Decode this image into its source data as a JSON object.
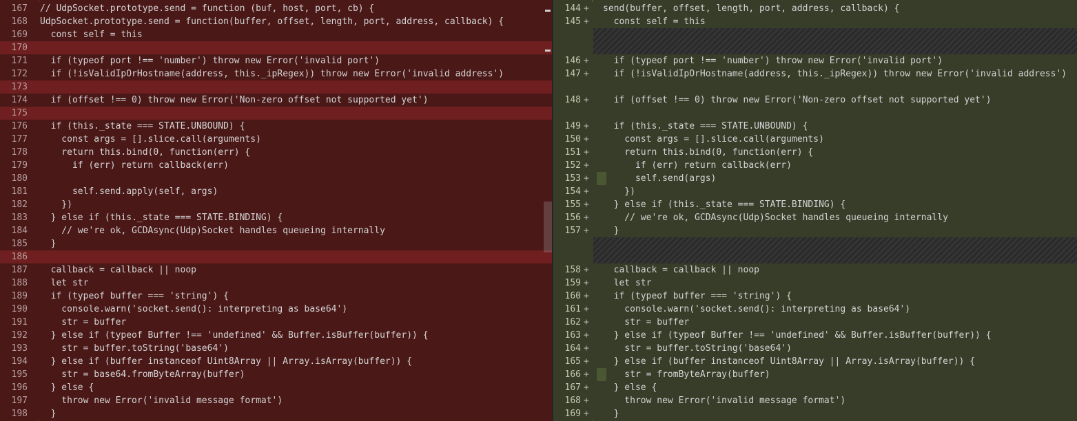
{
  "left": {
    "rows": [
      {
        "ln": "167",
        "code": "// UdpSocket.prototype.send = function (buf, host, port, cb) {"
      },
      {
        "ln": "168",
        "code": "UdpSocket.prototype.send = function(buffer, offset, length, port, address, callback) {"
      },
      {
        "ln": "169",
        "code": "  const self = this"
      },
      {
        "ln": "170",
        "code": ""
      },
      {
        "ln": "171",
        "code": "  if (typeof port !== 'number') throw new Error('invalid port')"
      },
      {
        "ln": "172",
        "code": "  if (!isValidIpOrHostname(address, this._ipRegex)) throw new Error('invalid address')"
      },
      {
        "ln": "173",
        "code": ""
      },
      {
        "ln": "174",
        "code": "  if (offset !== 0) throw new Error('Non-zero offset not supported yet')"
      },
      {
        "ln": "175",
        "code": ""
      },
      {
        "ln": "176",
        "code": "  if (this._state === STATE.UNBOUND) {"
      },
      {
        "ln": "177",
        "code": "    const args = [].slice.call(arguments)"
      },
      {
        "ln": "178",
        "code": "    return this.bind(0, function(err) {"
      },
      {
        "ln": "179",
        "code": "      if (err) return callback(err)"
      },
      {
        "ln": "180",
        "code": ""
      },
      {
        "ln": "181",
        "code": "      self.send.apply(self, args)"
      },
      {
        "ln": "182",
        "code": "    })"
      },
      {
        "ln": "183",
        "code": "  } else if (this._state === STATE.BINDING) {"
      },
      {
        "ln": "184",
        "code": "    // we're ok, GCDAsync(Udp)Socket handles queueing internally"
      },
      {
        "ln": "185",
        "code": "  }"
      },
      {
        "ln": "186",
        "code": ""
      },
      {
        "ln": "187",
        "code": "  callback = callback || noop"
      },
      {
        "ln": "188",
        "code": "  let str"
      },
      {
        "ln": "189",
        "code": "  if (typeof buffer === 'string') {"
      },
      {
        "ln": "190",
        "code": "    console.warn('socket.send(): interpreting as base64')"
      },
      {
        "ln": "191",
        "code": "    str = buffer"
      },
      {
        "ln": "192",
        "code": "  } else if (typeof Buffer !== 'undefined' && Buffer.isBuffer(buffer)) {"
      },
      {
        "ln": "193",
        "code": "    str = buffer.toString('base64')"
      },
      {
        "ln": "194",
        "code": "  } else if (buffer instanceof Uint8Array || Array.isArray(buffer)) {"
      },
      {
        "ln": "195",
        "code": "    str = base64.fromByteArray(buffer)"
      },
      {
        "ln": "196",
        "code": "  } else {"
      },
      {
        "ln": "197",
        "code": "    throw new Error('invalid message format')"
      },
      {
        "ln": "198",
        "code": "  }"
      }
    ]
  },
  "right": {
    "rows": [
      {
        "ln": "144",
        "sign": "+",
        "code": "send(buffer, offset, length, port, address, callback) {"
      },
      {
        "ln": "145",
        "sign": "+",
        "code": "  const self = this"
      },
      {
        "ln": "",
        "sign": "",
        "code": ""
      },
      {
        "ln": "",
        "sign": "",
        "code": ""
      },
      {
        "ln": "146",
        "sign": "+",
        "code": "  if (typeof port !== 'number') throw new Error('invalid port')"
      },
      {
        "ln": "147",
        "sign": "+",
        "code": "  if (!isValidIpOrHostname(address, this._ipRegex)) throw new Error('invalid address')"
      },
      {
        "ln": "",
        "sign": "",
        "code": ""
      },
      {
        "ln": "148",
        "sign": "+",
        "code": "  if (offset !== 0) throw new Error('Non-zero offset not supported yet')"
      },
      {
        "ln": "",
        "sign": "",
        "code": ""
      },
      {
        "ln": "149",
        "sign": "+",
        "code": "  if (this._state === STATE.UNBOUND) {"
      },
      {
        "ln": "150",
        "sign": "+",
        "code": "    const args = [].slice.call(arguments)"
      },
      {
        "ln": "151",
        "sign": "+",
        "code": "    return this.bind(0, function(err) {"
      },
      {
        "ln": "152",
        "sign": "+",
        "code": "      if (err) return callback(err)"
      },
      {
        "ln": "153",
        "sign": "+",
        "code": "      self.send(args)"
      },
      {
        "ln": "154",
        "sign": "+",
        "code": "    })"
      },
      {
        "ln": "155",
        "sign": "+",
        "code": "  } else if (this._state === STATE.BINDING) {"
      },
      {
        "ln": "156",
        "sign": "+",
        "code": "    // we're ok, GCDAsync(Udp)Socket handles queueing internally"
      },
      {
        "ln": "157",
        "sign": "+",
        "code": "  }"
      },
      {
        "ln": "",
        "sign": "",
        "code": ""
      },
      {
        "ln": "",
        "sign": "",
        "code": ""
      },
      {
        "ln": "158",
        "sign": "+",
        "code": "  callback = callback || noop"
      },
      {
        "ln": "159",
        "sign": "+",
        "code": "  let str"
      },
      {
        "ln": "160",
        "sign": "+",
        "code": "  if (typeof buffer === 'string') {"
      },
      {
        "ln": "161",
        "sign": "+",
        "code": "    console.warn('socket.send(): interpreting as base64')"
      },
      {
        "ln": "162",
        "sign": "+",
        "code": "    str = buffer"
      },
      {
        "ln": "163",
        "sign": "+",
        "code": "  } else if (typeof Buffer !== 'undefined' && Buffer.isBuffer(buffer)) {"
      },
      {
        "ln": "164",
        "sign": "+",
        "code": "    str = buffer.toString('base64')"
      },
      {
        "ln": "165",
        "sign": "+",
        "code": "  } else if (buffer instanceof Uint8Array || Array.isArray(buffer)) {"
      },
      {
        "ln": "166",
        "sign": "+",
        "code": "    str = fromByteArray(buffer)"
      },
      {
        "ln": "167",
        "sign": "+",
        "code": "  } else {"
      },
      {
        "ln": "168",
        "sign": "+",
        "code": "    throw new Error('invalid message format')"
      },
      {
        "ln": "169",
        "sign": "+",
        "code": "  }"
      }
    ]
  },
  "left_empty_rows": [
    "170",
    "173",
    "175",
    "186"
  ],
  "right_hatch_blocks": [
    "170",
    "186"
  ]
}
